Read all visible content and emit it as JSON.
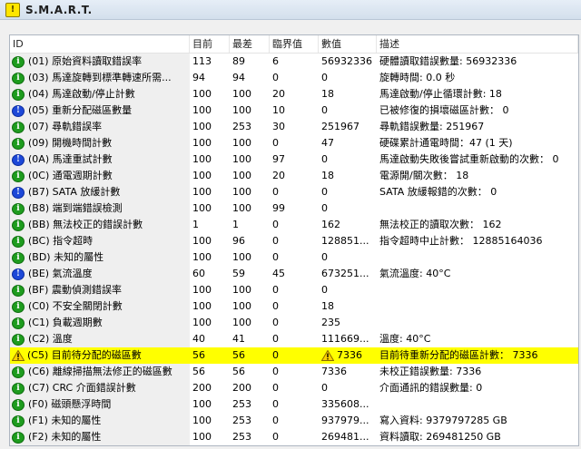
{
  "window": {
    "title": "S.M.A.R.T."
  },
  "columns": {
    "id": "ID",
    "current": "目前",
    "worst": "最差",
    "threshold": "臨界值",
    "raw": "數值",
    "desc": "描述"
  },
  "rows": [
    {
      "icon": "green-info-icon",
      "id": "(01) 原始資料讀取錯誤率",
      "cur": "113",
      "worst": "89",
      "thr": "6",
      "raw": "56932336",
      "desc": "硬體讀取錯誤數量: 56932336"
    },
    {
      "icon": "green-info-icon",
      "id": "(03) 馬達旋轉到標準轉速所需...",
      "cur": "94",
      "worst": "94",
      "thr": "0",
      "raw": "0",
      "desc": "旋轉時間: 0.0 秒"
    },
    {
      "icon": "green-info-icon",
      "id": "(04) 馬達啟動/停止計數",
      "cur": "100",
      "worst": "100",
      "thr": "20",
      "raw": "18",
      "desc": "馬達啟動/停止循環計數: 18"
    },
    {
      "icon": "blue-info-icon",
      "id": "(05) 重新分配磁區數量",
      "cur": "100",
      "worst": "100",
      "thr": "10",
      "raw": "0",
      "desc": "已被修復的損壞磁區計數： 0"
    },
    {
      "icon": "green-info-icon",
      "id": "(07) 尋軌錯誤率",
      "cur": "100",
      "worst": "253",
      "thr": "30",
      "raw": "251967",
      "desc": "尋軌錯誤數量: 251967"
    },
    {
      "icon": "green-info-icon",
      "id": "(09) 開機時間計數",
      "cur": "100",
      "worst": "100",
      "thr": "0",
      "raw": "47",
      "desc": "硬碟累計通電時間：47 (1 天)"
    },
    {
      "icon": "blue-info-icon",
      "id": "(0A) 馬達重試計數",
      "cur": "100",
      "worst": "100",
      "thr": "97",
      "raw": "0",
      "desc": "馬達啟動失敗後嘗試重新啟動的次數： 0"
    },
    {
      "icon": "green-info-icon",
      "id": "(0C) 通電週期計數",
      "cur": "100",
      "worst": "100",
      "thr": "20",
      "raw": "18",
      "desc": "電源開/關次數： 18"
    },
    {
      "icon": "blue-info-icon",
      "id": "(B7) SATA 放緩計數",
      "cur": "100",
      "worst": "100",
      "thr": "0",
      "raw": "0",
      "desc": "SATA 放緩報錯的次數： 0"
    },
    {
      "icon": "green-info-icon",
      "id": "(B8) 端到端錯誤檢測",
      "cur": "100",
      "worst": "100",
      "thr": "99",
      "raw": "0",
      "desc": ""
    },
    {
      "icon": "green-info-icon",
      "id": "(BB) 無法校正的錯誤計數",
      "cur": "1",
      "worst": "1",
      "thr": "0",
      "raw": "162",
      "desc": "無法校正的讀取次數： 162"
    },
    {
      "icon": "green-info-icon",
      "id": "(BC) 指令超時",
      "cur": "100",
      "worst": "96",
      "thr": "0",
      "raw": "128851...",
      "desc": "指令超時中止計數： 12885164036"
    },
    {
      "icon": "green-info-icon",
      "id": "(BD) 未知的屬性",
      "cur": "100",
      "worst": "100",
      "thr": "0",
      "raw": "0",
      "desc": ""
    },
    {
      "icon": "blue-info-icon",
      "id": "(BE) 氣流溫度",
      "cur": "60",
      "worst": "59",
      "thr": "45",
      "raw": "673251...",
      "desc": "氣流溫度: 40°C"
    },
    {
      "icon": "green-info-icon",
      "id": "(BF) 震動偵測錯誤率",
      "cur": "100",
      "worst": "100",
      "thr": "0",
      "raw": "0",
      "desc": ""
    },
    {
      "icon": "green-info-icon",
      "id": "(C0) 不安全關閉計數",
      "cur": "100",
      "worst": "100",
      "thr": "0",
      "raw": "18",
      "desc": ""
    },
    {
      "icon": "green-info-icon",
      "id": "(C1) 負載週期數",
      "cur": "100",
      "worst": "100",
      "thr": "0",
      "raw": "235",
      "desc": ""
    },
    {
      "icon": "green-info-icon",
      "id": "(C2) 溫度",
      "cur": "40",
      "worst": "41",
      "thr": "0",
      "raw": "111669...",
      "desc": "溫度: 40°C"
    },
    {
      "icon": "warning-icon",
      "id": "(C5) 目前待分配的磁區數",
      "cur": "56",
      "worst": "56",
      "thr": "0",
      "raw": "7336",
      "desc": "目前待重新分配的磁區計數： 7336",
      "highlight": true
    },
    {
      "icon": "green-info-icon",
      "id": "(C6) 離線掃描無法修正的磁區數",
      "cur": "56",
      "worst": "56",
      "thr": "0",
      "raw": "7336",
      "desc": "未校正錯誤數量: 7336"
    },
    {
      "icon": "green-info-icon",
      "id": "(C7) CRC 介面錯誤計數",
      "cur": "200",
      "worst": "200",
      "thr": "0",
      "raw": "0",
      "desc": "介面通訊的錯誤數量: 0"
    },
    {
      "icon": "green-info-icon",
      "id": "(F0) 磁頭懸浮時間",
      "cur": "100",
      "worst": "253",
      "thr": "0",
      "raw": "335608...",
      "desc": ""
    },
    {
      "icon": "green-info-icon",
      "id": "(F1) 未知的屬性",
      "cur": "100",
      "worst": "253",
      "thr": "0",
      "raw": "937979...",
      "desc": "寫入資料: 9379797285 GB"
    },
    {
      "icon": "green-info-icon",
      "id": "(F2) 未知的屬性",
      "cur": "100",
      "worst": "253",
      "thr": "0",
      "raw": "269481...",
      "desc": "資料讀取: 269481250 GB"
    }
  ]
}
